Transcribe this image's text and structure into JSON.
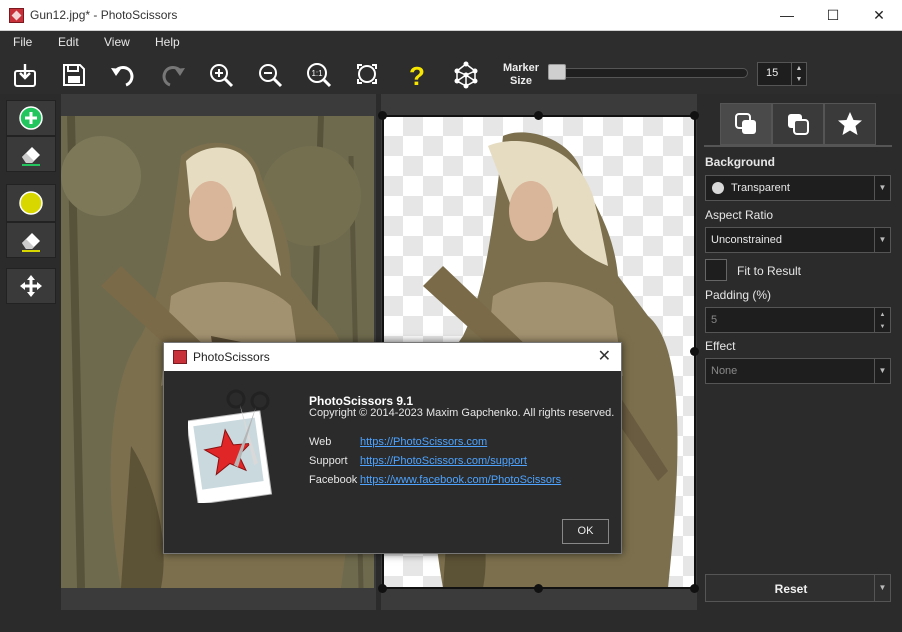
{
  "window": {
    "title": "Gun12.jpg* - PhotoScissors",
    "controls": [
      "—",
      "☐",
      "✕"
    ]
  },
  "menu": [
    "File",
    "Edit",
    "View",
    "Help"
  ],
  "toolbar": {
    "marker_label_line1": "Marker",
    "marker_label_line2": "Size",
    "marker_size_value": "15",
    "marker_slider_level": 0.0,
    "icons": [
      "open-icon",
      "save-icon",
      "undo-icon",
      "redo-icon",
      "zoom-in-icon",
      "zoom-out-icon",
      "zoom-actual-icon",
      "zoom-fit-icon",
      "help-icon",
      "network-icon"
    ]
  },
  "left_tools": [
    "add-marker-tool",
    "eraser-tool",
    "background-marker-tool",
    "background-eraser-tool",
    "move-tool"
  ],
  "right_panel": {
    "tabs": [
      "background-tab",
      "foreground-tab",
      "effects-tab"
    ],
    "background_label": "Background",
    "background_value": "Transparent",
    "aspect_ratio_label": "Aspect Ratio",
    "aspect_ratio_value": "Unconstrained",
    "fit_to_result_label": "Fit to Result",
    "padding_label": "Padding (%)",
    "padding_value": "5",
    "effect_label": "Effect",
    "effect_value": "None",
    "reset_label": "Reset"
  },
  "dialog": {
    "title": "PhotoScissors",
    "product": "PhotoScissors 9.1",
    "copyright": "Copyright © 2014-2023 Maxim Gapchenko. All rights reserved.",
    "web_label": "Web",
    "web_url": "https://PhotoScissors.com",
    "support_label": "Support",
    "support_url": "https://PhotoScissors.com/support",
    "facebook_label": "Facebook",
    "facebook_url": "https://www.facebook.com/PhotoScissors",
    "ok_label": "OK"
  },
  "colors": {
    "accent_green": "#22c55e",
    "marker_yellow": "#d8d800",
    "help_yellow": "#f7e600",
    "link_blue": "#4da3ff"
  }
}
